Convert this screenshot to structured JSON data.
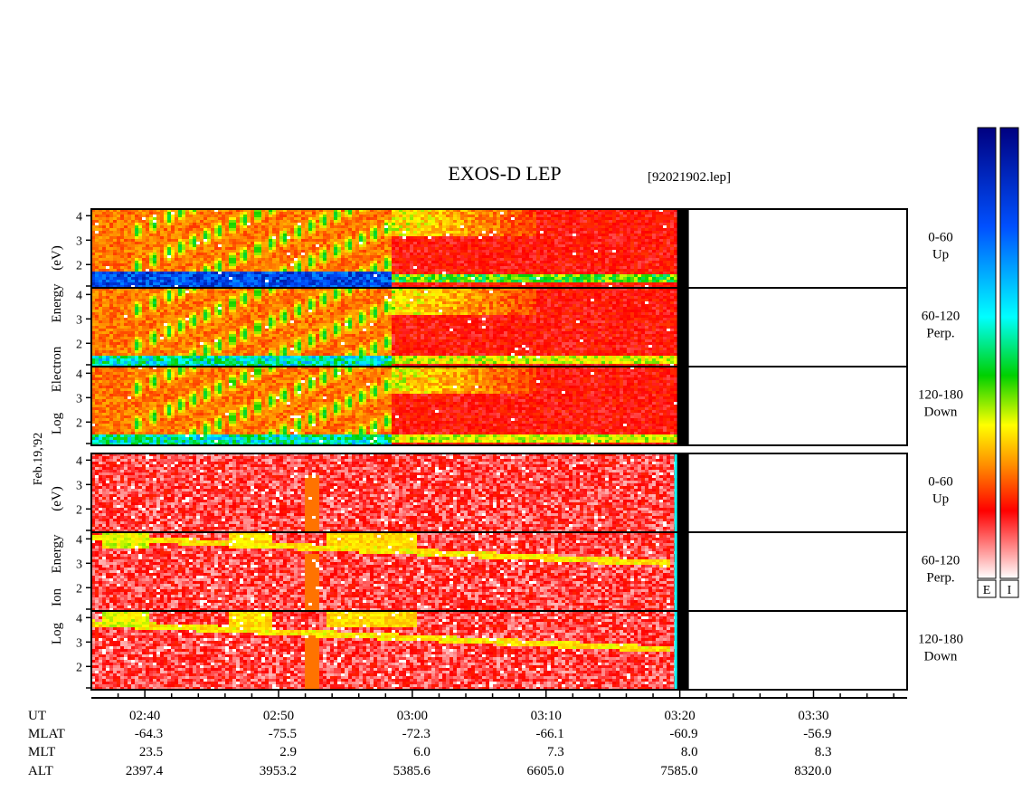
{
  "chart_data": {
    "type": "heatmap",
    "title": "EXOS-D LEP",
    "file_label": "[92021902.lep]",
    "date_label": "Feb.19,'92",
    "colorscale": [
      "#ffffff",
      "#ff0000",
      "#ff8c00",
      "#ffff00",
      "#00d000",
      "#00ffff",
      "#0050ff",
      "#000080"
    ],
    "colorbar_labels": [
      "E",
      "I"
    ],
    "groups": [
      {
        "name": "electron",
        "ylabel": "Log Electron Energy (eV)",
        "ylabel_parts": [
          "Log",
          "Electron",
          "Energy",
          "(eV)"
        ],
        "panels": [
          {
            "label_angle": "0-60",
            "label_dir": "Up"
          },
          {
            "label_angle": "60-120",
            "label_dir": "Perp."
          },
          {
            "label_angle": "120-180",
            "label_dir": "Down"
          }
        ]
      },
      {
        "name": "ion",
        "ylabel": "Log Ion Energy (eV)",
        "ylabel_parts": [
          "Log",
          "Ion",
          "Energy",
          "(eV)"
        ],
        "panels": [
          {
            "label_angle": "0-60",
            "label_dir": "Up"
          },
          {
            "label_angle": "60-120",
            "label_dir": "Perp."
          },
          {
            "label_angle": "120-180",
            "label_dir": "Down"
          }
        ]
      }
    ],
    "ytick_labels": [
      "4",
      "3",
      "2"
    ],
    "xaxis": {
      "start": "02:36",
      "end": "03:37",
      "data_end": "03:20",
      "row_headers": [
        "UT",
        "MLAT",
        "MLT",
        "ALT"
      ],
      "ticks": [
        {
          "ut": "02:40",
          "mlat": "-64.3",
          "mlt": "23.5",
          "alt": "2397.4"
        },
        {
          "ut": "02:50",
          "mlat": "-75.5",
          "mlt": "2.9",
          "alt": "3953.2"
        },
        {
          "ut": "03:00",
          "mlat": "-72.3",
          "mlt": "6.0",
          "alt": "5385.6"
        },
        {
          "ut": "03:10",
          "mlat": "-66.1",
          "mlt": "7.3",
          "alt": "6605.0"
        },
        {
          "ut": "03:20",
          "mlat": "-60.9",
          "mlt": "8.0",
          "alt": "7585.0"
        },
        {
          "ut": "03:30",
          "mlat": "-56.9",
          "mlt": "8.3",
          "alt": "8320.0"
        }
      ]
    }
  }
}
